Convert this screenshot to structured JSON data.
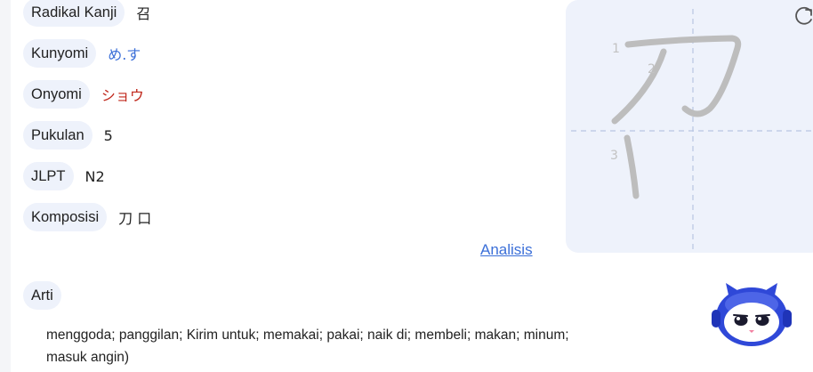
{
  "details": [
    {
      "key": "radical",
      "label": "Radikal Kanji",
      "value": "召",
      "value_color": "dark"
    },
    {
      "key": "kunyomi",
      "label": "Kunyomi",
      "value": "め.す",
      "value_color": "blue"
    },
    {
      "key": "onyomi",
      "label": "Onyomi",
      "value": "ショウ",
      "value_color": "red"
    },
    {
      "key": "strokes",
      "label": "Pukulan",
      "value": "5",
      "value_color": "dark"
    },
    {
      "key": "jlpt",
      "label": "JLPT",
      "value": "N2",
      "value_color": "dark"
    },
    {
      "key": "composition",
      "label": "Komposisi",
      "value": "刀 口",
      "value_color": "dark"
    }
  ],
  "analysis_link": "Analisis",
  "meaning_label": "Arti",
  "meaning_text": "menggoda; panggilan; Kirim untuk; memakai; pakai; naik di; membeli; makan; minum; masuk angin)",
  "stroke_panel": {
    "stroke_numbers": [
      "1",
      "2",
      "3"
    ],
    "refresh_icon": "refresh-icon"
  },
  "mascot_icon": "robot-cat-mascot-icon",
  "colors": {
    "accent": "#3b6fd8",
    "onyomi": "#c0281c",
    "pill_bg": "#eef2fb",
    "stroke_gray": "#bdbdbd"
  }
}
